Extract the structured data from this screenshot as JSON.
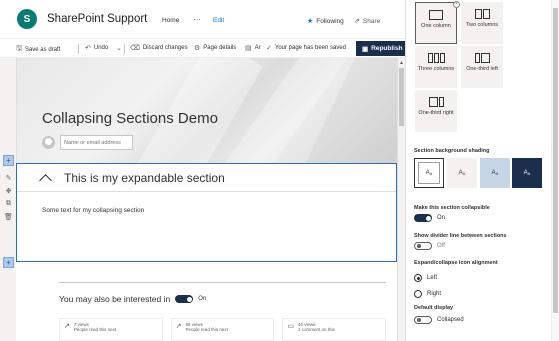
{
  "header": {
    "logo_letter": "S",
    "site_title": "SharePoint Support",
    "nav_home": "Home",
    "nav_more": "···",
    "nav_edit": "Edit",
    "following": "Following",
    "share": "Share"
  },
  "commandbar": {
    "save_draft": "Save as draft",
    "undo": "Undo",
    "discard": "Discard changes",
    "page_details": "Page details",
    "analytics": "Ar",
    "status": "Your page has been saved",
    "republish": "Republish"
  },
  "page": {
    "title": "Collapsing Sections Demo",
    "author_placeholder": "Name or email address"
  },
  "section": {
    "heading": "This is my expandable section",
    "body": "Some text for my collapsing section"
  },
  "interest": {
    "label": "You may also be interested in",
    "toggle_label": "On",
    "toggle_on": true,
    "cards": [
      {
        "metric": "7 views",
        "detail": "People read this next",
        "icon": "trending-icon"
      },
      {
        "metric": "98 views",
        "detail": "People read this next",
        "icon": "trending-icon"
      },
      {
        "metric": "40 views",
        "detail": "1 comment on this",
        "icon": "comment-icon"
      }
    ]
  },
  "pane": {
    "layouts": [
      {
        "label": "One column",
        "selected": true
      },
      {
        "label": "Two columns",
        "selected": false
      },
      {
        "label": "Three columns",
        "selected": false
      },
      {
        "label": "One-third left",
        "selected": false
      },
      {
        "label": "One-third right",
        "selected": false
      }
    ],
    "shading_label": "Section background shading",
    "shade_glyph": "A",
    "shade_glyph_sub": "A",
    "collapsible_label": "Make this section collapsible",
    "collapsible_value": "On",
    "divider_label": "Show divider line between sections",
    "divider_value": "Off",
    "alignment_label": "Expand/collapse icon alignment",
    "alignment_left": "Left",
    "alignment_right": "Right",
    "default_label": "Default display",
    "default_value": "Collapsed",
    "colors": {
      "accent": "#1b2e4c",
      "section_border": "#2a6ebb"
    }
  }
}
